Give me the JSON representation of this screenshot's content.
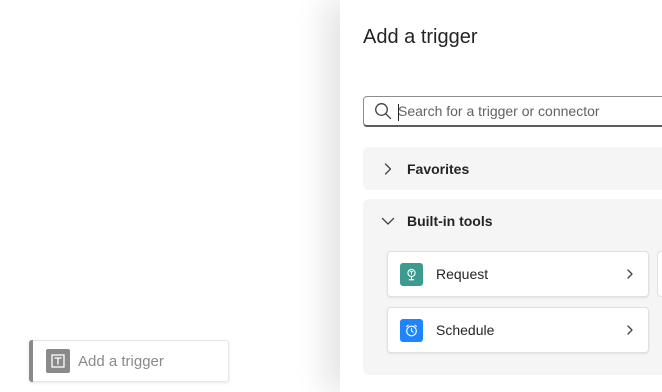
{
  "canvas": {
    "trigger_card": {
      "label": "Add a trigger",
      "icon": "trigger-placeholder-icon"
    }
  },
  "panel": {
    "title": "Add a trigger",
    "search": {
      "placeholder": "Search for a trigger or connector",
      "icon": "search-icon"
    },
    "sections": {
      "favorites": {
        "label": "Favorites",
        "state": "collapsed"
      },
      "builtin": {
        "label": "Built-in tools",
        "state": "expanded",
        "items": [
          {
            "label": "Request",
            "icon": "request-icon",
            "color": "#3c9a8f"
          },
          {
            "label": "Schedule",
            "icon": "clock-icon",
            "color": "#1f85ff"
          }
        ]
      }
    }
  },
  "colors": {
    "accent_gray": "#8a8a8a",
    "section_bg": "#f5f5f5"
  }
}
